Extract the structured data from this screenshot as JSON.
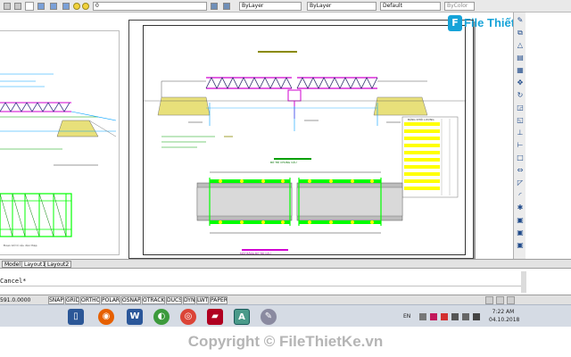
{
  "toolbar": {
    "layer_value": "0",
    "color_value": "ByLayer",
    "linetype_value": "ByLayer",
    "lineweight_value": "Default",
    "plotstyle_value": "ByColor"
  },
  "watermark": {
    "badge": "F",
    "logo_text": "File Thiết Kế.vn"
  },
  "drawing": {
    "left_sheet_note": "Đoạn bố trí cầu dàn thép",
    "plan_title": "BỐ TRÍ CHUNG CẦU",
    "title_block_note": "BẢNG KHỐI LƯỢNG",
    "bottom_title": "MẶT BẰNG BỐ TRÍ CẦU"
  },
  "tabs": [
    "Model",
    "Layout1",
    "Layout2"
  ],
  "active_tab": "Layout1",
  "command": {
    "history": "",
    "prompt": "Cancel*"
  },
  "status": {
    "coords": "591.0.0000",
    "buttons": [
      "SNAP",
      "GRID",
      "ORTHO",
      "POLAR",
      "OSNAP",
      "OTRACK",
      "DUCS",
      "DYN",
      "LWT",
      "PAPER"
    ]
  },
  "taskbar": {
    "language": "EN",
    "time": "7:22 AM",
    "date": "04.10.2018"
  },
  "footer": {
    "copyright": "Copyright © FileThietKe.vn"
  },
  "colors": {
    "accent": "#16a3d8",
    "drawing_green": "#00ff00",
    "drawing_yellow": "#ffff00",
    "drawing_magenta": "#d100d1"
  }
}
